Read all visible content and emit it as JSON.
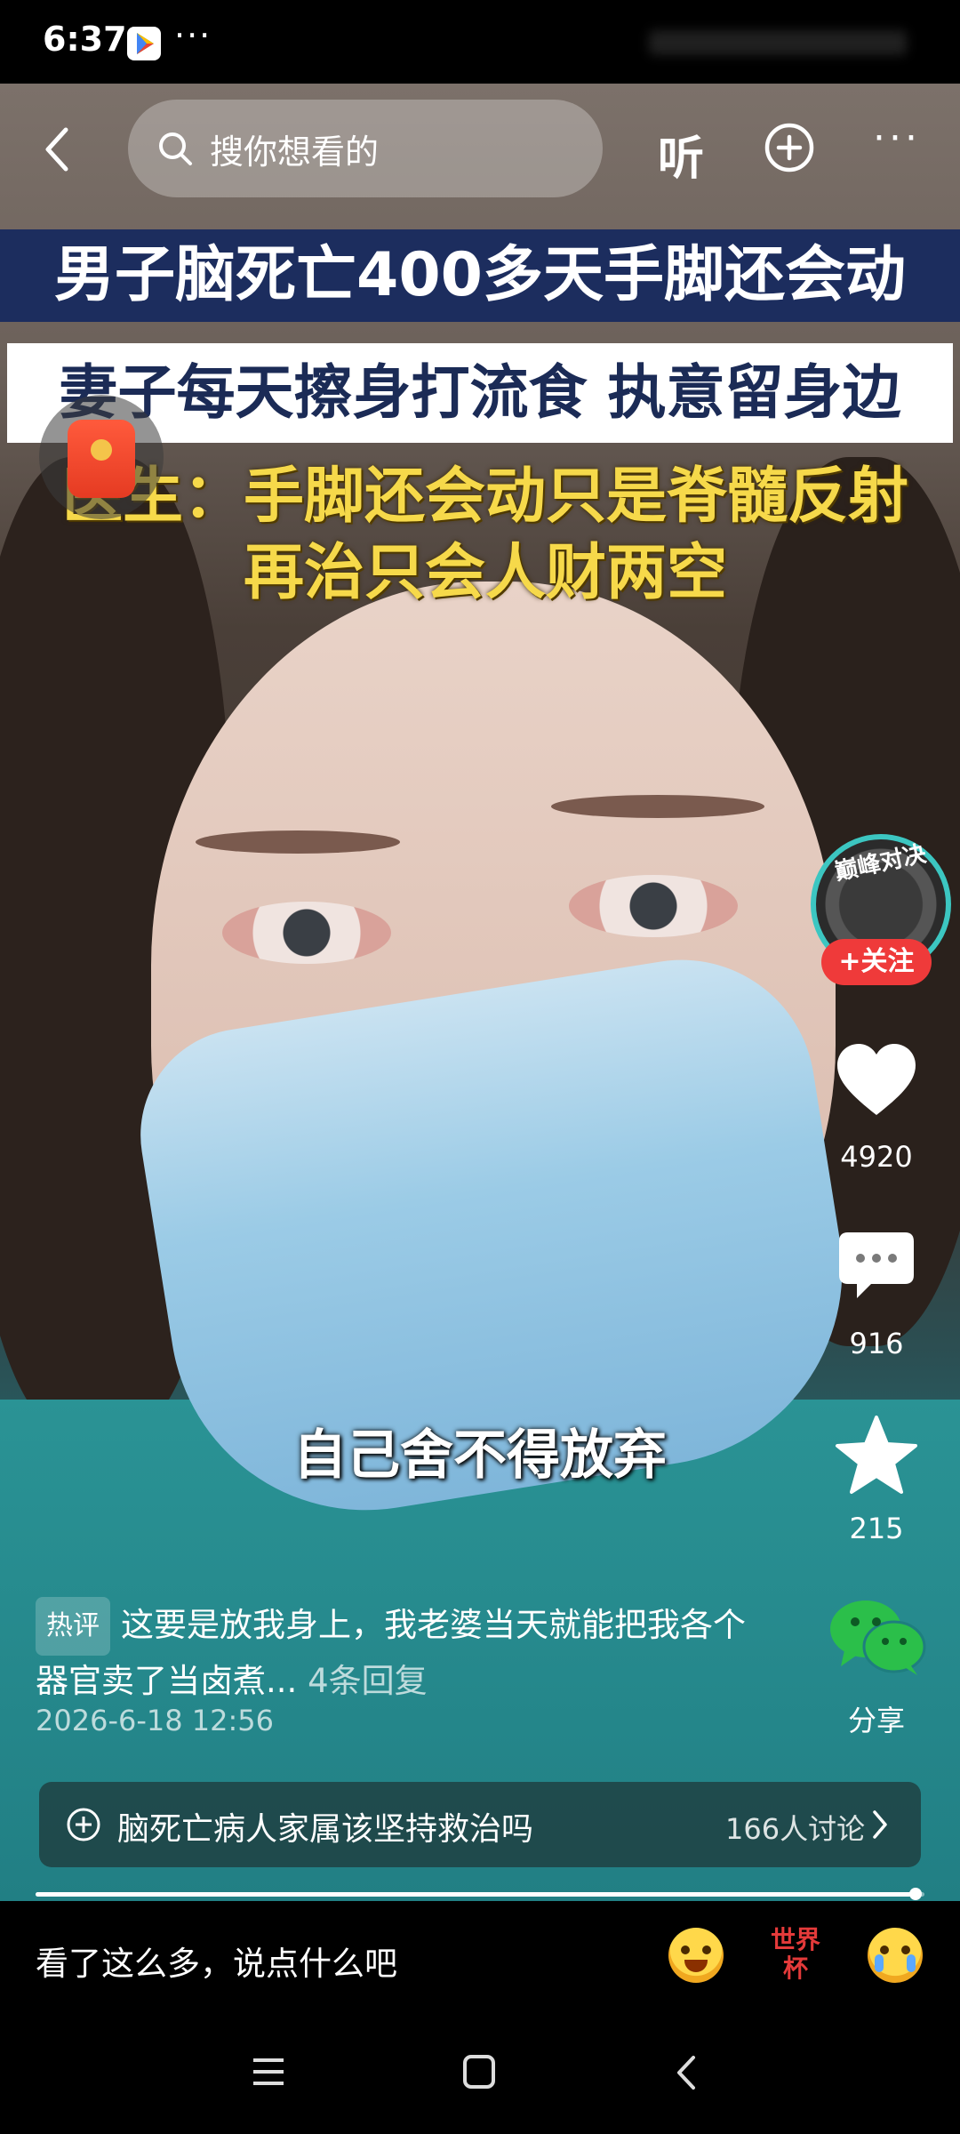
{
  "status": {
    "time": "6:37",
    "more": "···"
  },
  "topnav": {
    "search_placeholder": "搜你想看的",
    "listen_label": "听",
    "more_label": "···"
  },
  "headline": {
    "line1": "男子脑死亡400多天手脚还会动",
    "line2": "妻子每天擦身打流食 执意留身边",
    "line3a": "医生：手脚还会动只是脊髓反射",
    "line3b": "再治只会人财两空"
  },
  "video_subtitle": "自己舍不得放弃",
  "author": {
    "avatar_tag": "巅峰对决",
    "follow_label": "+关注"
  },
  "actions": {
    "likes": "4920",
    "comments": "916",
    "favorites": "215",
    "share_label": "分享"
  },
  "hot_comment": {
    "tag": "热评",
    "text": "这要是放我身上，我老婆当天就能把我各个器官卖了当卤煮...",
    "replies": "4条回复",
    "time": "2026-6-18 12:56"
  },
  "topic": {
    "text": "脑死亡病人家属该坚持救治吗",
    "count": "166人讨论"
  },
  "playback": {
    "progress": 0.99
  },
  "comment_bar": {
    "placeholder": "看了这么多，说点什么吧",
    "worldcup_label": "世界杯"
  },
  "colors": {
    "accent_red": "#ef3a3a",
    "headline_blue": "#1c2d5e",
    "headline_yellow": "#f6d94a",
    "share_green": "#2bbf4a"
  },
  "icons": [
    "back-icon",
    "search-icon",
    "add-icon",
    "more-icon",
    "red-packet-icon",
    "heart-icon",
    "comment-icon",
    "star-icon",
    "wechat-share-icon",
    "plus-circle-icon",
    "chevron-right-icon",
    "menu-icon",
    "home-icon",
    "nav-back-icon"
  ]
}
